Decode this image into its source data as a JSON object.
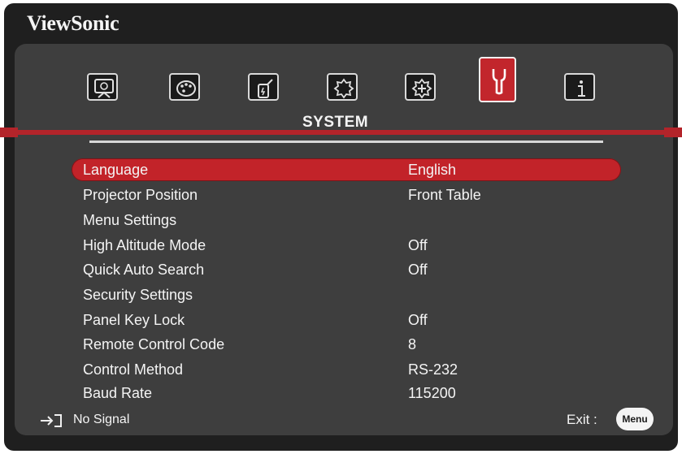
{
  "brand": "ViewSonic",
  "tabs": {
    "icons": [
      "display-icon",
      "picture-icon",
      "power-icon",
      "basic-icon",
      "advanced-icon",
      "system-icon",
      "information-icon"
    ],
    "active_index": 5,
    "active_title": "SYSTEM"
  },
  "menu": {
    "items": [
      {
        "label": "Language",
        "value": "English",
        "selected": true
      },
      {
        "label": "Projector Position",
        "value": "Front Table"
      },
      {
        "label": "Menu Settings",
        "value": ""
      },
      {
        "label": "High Altitude Mode",
        "value": "Off"
      },
      {
        "label": "Quick Auto Search",
        "value": "Off"
      },
      {
        "label": "Security Settings",
        "value": ""
      },
      {
        "label": "Panel Key Lock",
        "value": "Off"
      },
      {
        "label": "Remote Control Code",
        "value": "8"
      },
      {
        "label": "Control Method",
        "value": "RS-232"
      },
      {
        "label": "Baud Rate",
        "value": "115200"
      }
    ]
  },
  "footer": {
    "source_icon": "input-source-icon",
    "status": "No Signal",
    "exit_label": "Exit :",
    "menu_button": "Menu"
  },
  "colors": {
    "accent": "#c22329",
    "background": "#3e3e3e"
  }
}
